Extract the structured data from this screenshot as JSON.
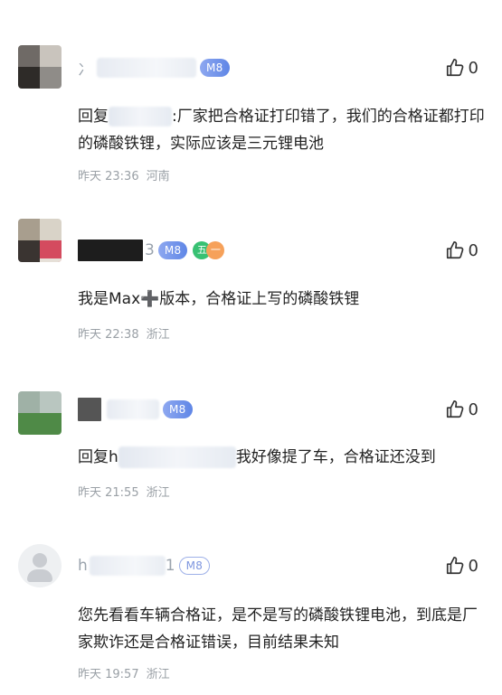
{
  "comments": [
    {
      "name_prefix": "冫",
      "name_suffix": "",
      "badge": "M8",
      "text_prefix": "回复",
      "text_sep": ":",
      "text_body": "厂家把合格证打印错了，我们的合格证都打印的磷酸铁锂，实际应该是三元锂电池",
      "time": "昨天 23:36",
      "location": "河南",
      "likes": "0"
    },
    {
      "name_suffix": "3",
      "badge": "M8",
      "level_a": "五",
      "level_b": "一",
      "text_body": "我是Max➕版本，合格证上写的磷酸铁锂",
      "time": "昨天 22:38",
      "location": "浙江",
      "likes": "0"
    },
    {
      "badge": "M8",
      "text_prefix": "回复h",
      "text_body": "我好像提了车，合格证还没到",
      "time": "昨天 21:55",
      "location": "浙江",
      "likes": "0"
    },
    {
      "name_prefix": "h",
      "name_suffix": "1",
      "badge": "M8",
      "text_body": "您先看看车辆合格证，是不是写的磷酸铁锂电池，到底是厂家欺诈还是合格证错误，目前结果未知",
      "time": "昨天 19:57",
      "location": "浙江",
      "likes": "0"
    }
  ],
  "icons": {
    "like": "thumbs-up-icon",
    "avatar_default": "user-silhouette-icon"
  },
  "colors": {
    "badge": "#6b8ee8",
    "meta_text": "#9aa0a6",
    "body_text": "#222222"
  }
}
